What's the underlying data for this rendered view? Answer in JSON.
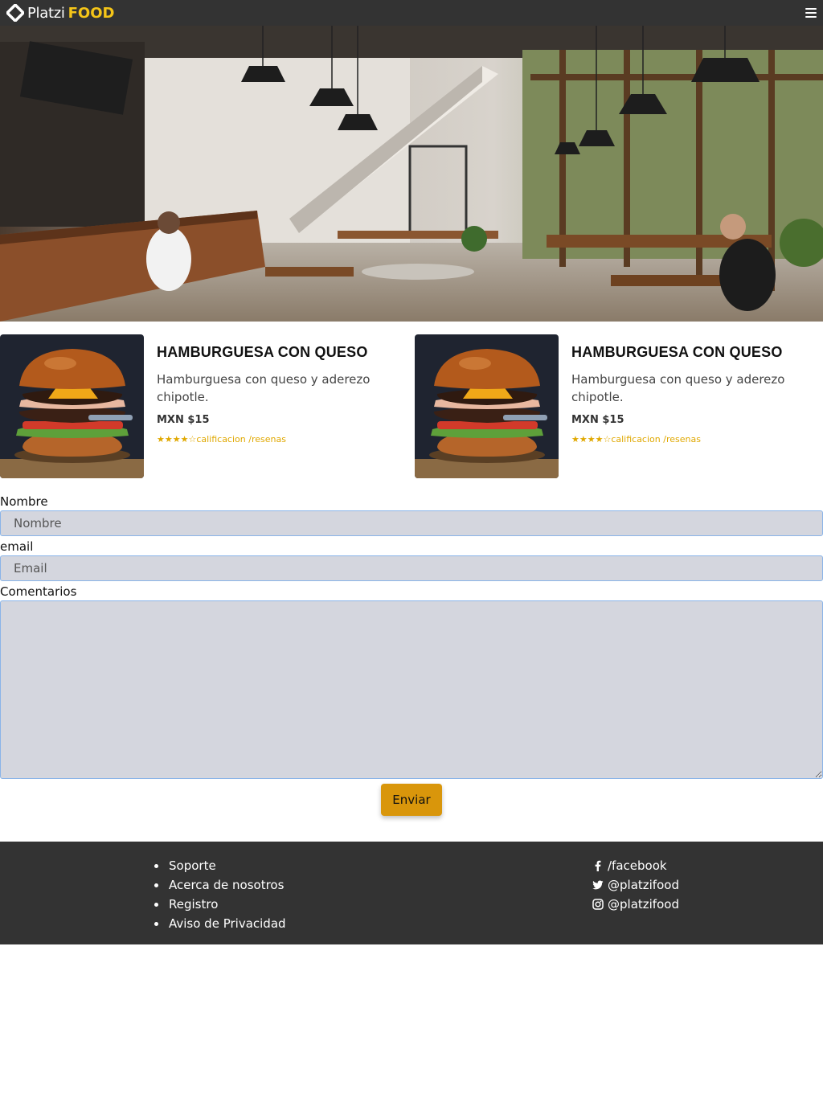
{
  "header": {
    "logo_text": "Platzi",
    "logo_accent": "FOOD",
    "menu_icon": "hamburger-menu-icon"
  },
  "hero": {
    "image": "restaurant-interior-photo"
  },
  "products": [
    {
      "title": "HAMBURGUESA CON QUESO",
      "description": "Hamburguesa con queso y aderezo chipotle.",
      "price": "MXN $15",
      "stars": "★★★★☆",
      "rating_text": "calificacion /resenas"
    },
    {
      "title": "HAMBURGUESA CON QUESO",
      "description": "Hamburguesa con queso y aderezo chipotle.",
      "price": "MXN $15",
      "stars": "★★★★☆",
      "rating_text": "calificacion /resenas"
    }
  ],
  "form": {
    "name_label": "Nombre",
    "name_placeholder": "Nombre",
    "email_label": "email",
    "email_placeholder": "Email",
    "comments_label": "Comentarios",
    "submit_label": "Enviar"
  },
  "footer": {
    "links": [
      "Soporte",
      "Acerca de nosotros",
      "Registro",
      "Aviso de Privacidad"
    ],
    "social": [
      {
        "icon": "facebook-icon",
        "text": "/facebook"
      },
      {
        "icon": "twitter-icon",
        "text": "@platzifood"
      },
      {
        "icon": "instagram-icon",
        "text": "@platzifood"
      }
    ]
  },
  "colors": {
    "bar": "#333333",
    "accent": "#f5c518",
    "button": "#d9960b",
    "rating": "#e0a800",
    "input_bg": "#d4d6de"
  }
}
